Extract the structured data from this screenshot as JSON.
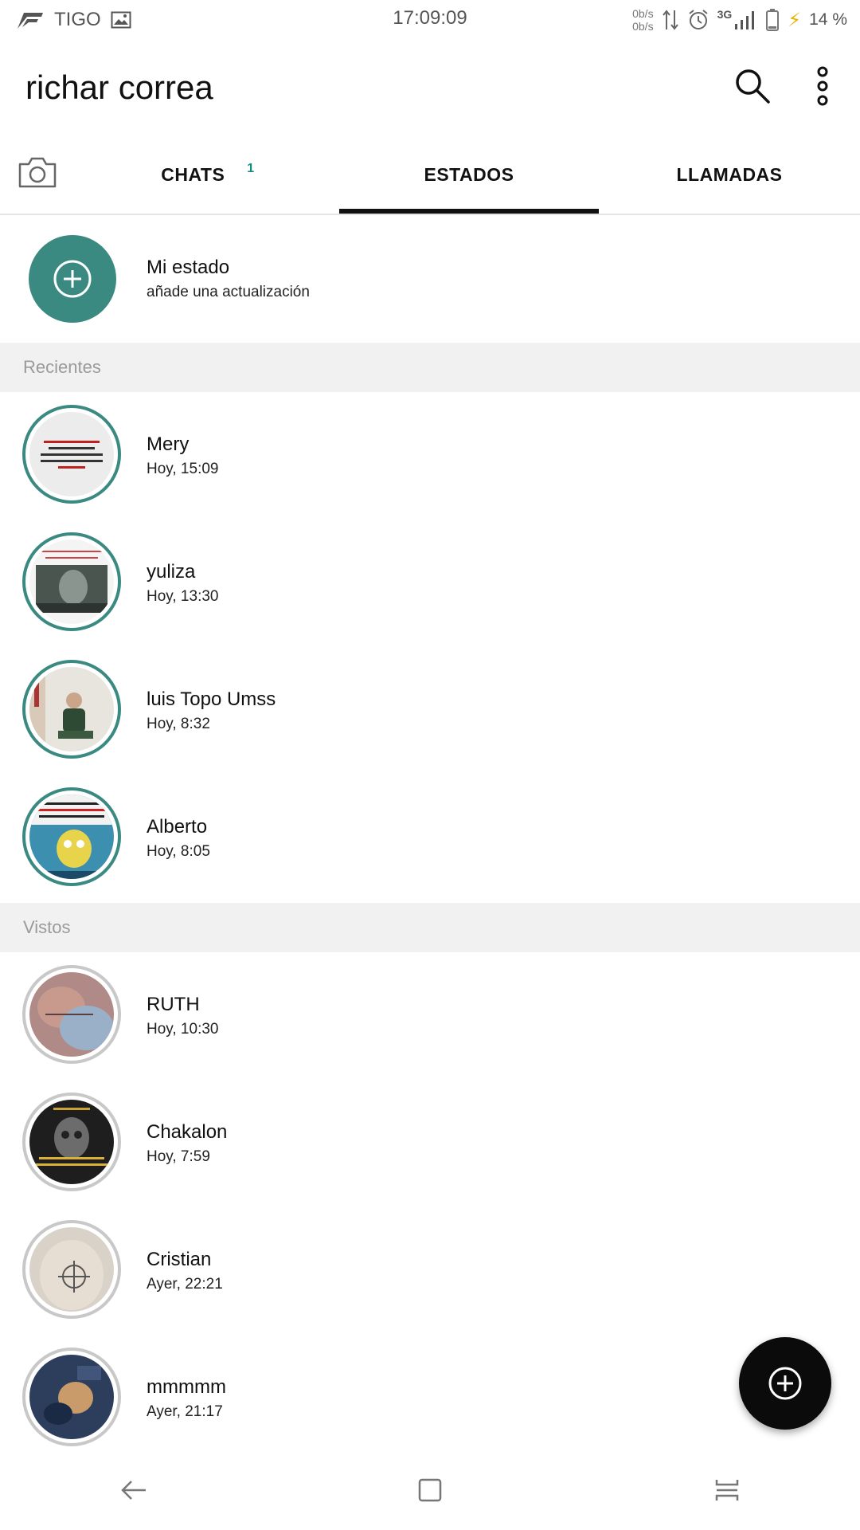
{
  "status_bar": {
    "carrier": "TIGO",
    "time": "17:09:09",
    "net_up": "0b/s",
    "net_down": "0b/s",
    "network_type": "3G",
    "battery": "14 %"
  },
  "header": {
    "title": "richar correa",
    "search_icon": "search-icon",
    "menu_icon": "more-vertical-icon"
  },
  "tabs": {
    "camera_icon": "camera-icon",
    "items": [
      {
        "label": "CHATS",
        "badge": "1",
        "active": false
      },
      {
        "label": "ESTADOS",
        "active": true
      },
      {
        "label": "LLAMADAS",
        "active": false
      }
    ]
  },
  "my_status": {
    "name": "Mi estado",
    "subtitle": "añade una actualización"
  },
  "recent": {
    "header": "Recientes",
    "items": [
      {
        "name": "Mery",
        "time": "Hoy, 15:09"
      },
      {
        "name": "yuliza",
        "time": "Hoy, 13:30"
      },
      {
        "name": "luis Topo Umss",
        "time": "Hoy, 8:32"
      },
      {
        "name": "Alberto",
        "time": "Hoy, 8:05"
      }
    ]
  },
  "seen": {
    "header": "Vistos",
    "items": [
      {
        "name": "RUTH",
        "time": "Hoy, 10:30"
      },
      {
        "name": "Chakalon",
        "time": "Hoy, 7:59"
      },
      {
        "name": "Cristian",
        "time": "Ayer, 22:21"
      },
      {
        "name": "mmmmm",
        "time": "Ayer, 21:17"
      }
    ]
  },
  "colors": {
    "accent": "#3a8a82",
    "seen_ring": "#c8c8c8",
    "fab": "#0b0b0b"
  }
}
